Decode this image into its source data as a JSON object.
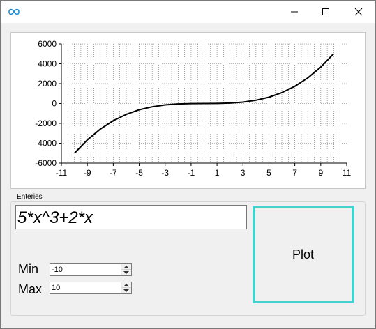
{
  "window": {
    "title": "",
    "app_icon": "infinity-icon",
    "controls": [
      "minimize-icon",
      "maximize-icon",
      "close-icon"
    ]
  },
  "chart_data": {
    "type": "line",
    "series": [
      {
        "color": "#000000",
        "x": [
          -10,
          -9,
          -8,
          -7,
          -6,
          -5,
          -4,
          -3,
          -2,
          -1,
          0,
          1,
          2,
          3,
          4,
          5,
          6,
          7,
          8,
          9,
          10
        ],
        "y": [
          -5020,
          -3663,
          -2576,
          -1729,
          -1092,
          -635,
          -328,
          -141,
          -44,
          -7,
          0,
          7,
          44,
          141,
          328,
          635,
          1092,
          1729,
          2576,
          3663,
          5020
        ]
      }
    ],
    "xlim": [
      -11,
      11
    ],
    "ylim": [
      -6000,
      6000
    ],
    "xticks": [
      -11,
      -9,
      -7,
      -5,
      -3,
      -1,
      1,
      3,
      5,
      7,
      9,
      11
    ],
    "yticks": [
      6000,
      4000,
      2000,
      0,
      -2000,
      -4000,
      -6000
    ],
    "grid": true
  },
  "entries": {
    "group_label": "Enteries",
    "formula": "5*x^3+2*x",
    "min_label": "Min",
    "min_value": "-10",
    "max_label": "Max",
    "max_value": "10",
    "plot_label": "Plot"
  },
  "colors": {
    "accent": "#45d1cc",
    "app_icon": "#1a8fd6"
  }
}
